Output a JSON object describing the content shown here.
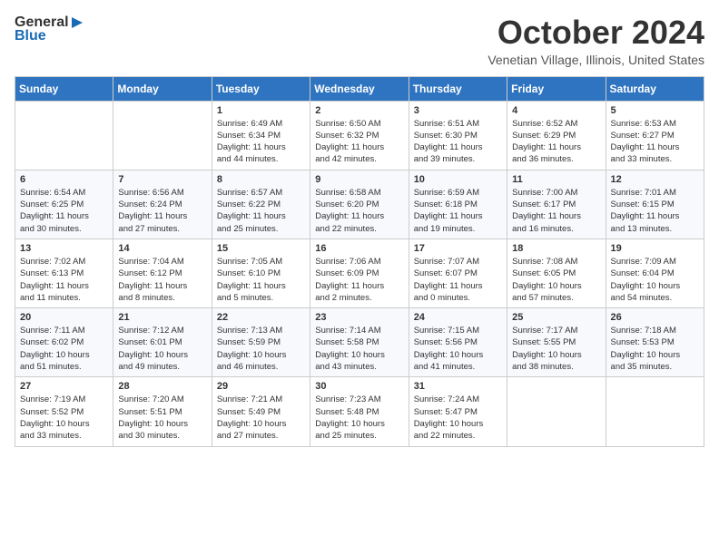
{
  "header": {
    "logo_general": "General",
    "logo_blue": "Blue",
    "month_title": "October 2024",
    "location": "Venetian Village, Illinois, United States"
  },
  "columns": [
    "Sunday",
    "Monday",
    "Tuesday",
    "Wednesday",
    "Thursday",
    "Friday",
    "Saturday"
  ],
  "weeks": [
    [
      {
        "day": "",
        "info": ""
      },
      {
        "day": "",
        "info": ""
      },
      {
        "day": "1",
        "info": "Sunrise: 6:49 AM\nSunset: 6:34 PM\nDaylight: 11 hours\nand 44 minutes."
      },
      {
        "day": "2",
        "info": "Sunrise: 6:50 AM\nSunset: 6:32 PM\nDaylight: 11 hours\nand 42 minutes."
      },
      {
        "day": "3",
        "info": "Sunrise: 6:51 AM\nSunset: 6:30 PM\nDaylight: 11 hours\nand 39 minutes."
      },
      {
        "day": "4",
        "info": "Sunrise: 6:52 AM\nSunset: 6:29 PM\nDaylight: 11 hours\nand 36 minutes."
      },
      {
        "day": "5",
        "info": "Sunrise: 6:53 AM\nSunset: 6:27 PM\nDaylight: 11 hours\nand 33 minutes."
      }
    ],
    [
      {
        "day": "6",
        "info": "Sunrise: 6:54 AM\nSunset: 6:25 PM\nDaylight: 11 hours\nand 30 minutes."
      },
      {
        "day": "7",
        "info": "Sunrise: 6:56 AM\nSunset: 6:24 PM\nDaylight: 11 hours\nand 27 minutes."
      },
      {
        "day": "8",
        "info": "Sunrise: 6:57 AM\nSunset: 6:22 PM\nDaylight: 11 hours\nand 25 minutes."
      },
      {
        "day": "9",
        "info": "Sunrise: 6:58 AM\nSunset: 6:20 PM\nDaylight: 11 hours\nand 22 minutes."
      },
      {
        "day": "10",
        "info": "Sunrise: 6:59 AM\nSunset: 6:18 PM\nDaylight: 11 hours\nand 19 minutes."
      },
      {
        "day": "11",
        "info": "Sunrise: 7:00 AM\nSunset: 6:17 PM\nDaylight: 11 hours\nand 16 minutes."
      },
      {
        "day": "12",
        "info": "Sunrise: 7:01 AM\nSunset: 6:15 PM\nDaylight: 11 hours\nand 13 minutes."
      }
    ],
    [
      {
        "day": "13",
        "info": "Sunrise: 7:02 AM\nSunset: 6:13 PM\nDaylight: 11 hours\nand 11 minutes."
      },
      {
        "day": "14",
        "info": "Sunrise: 7:04 AM\nSunset: 6:12 PM\nDaylight: 11 hours\nand 8 minutes."
      },
      {
        "day": "15",
        "info": "Sunrise: 7:05 AM\nSunset: 6:10 PM\nDaylight: 11 hours\nand 5 minutes."
      },
      {
        "day": "16",
        "info": "Sunrise: 7:06 AM\nSunset: 6:09 PM\nDaylight: 11 hours\nand 2 minutes."
      },
      {
        "day": "17",
        "info": "Sunrise: 7:07 AM\nSunset: 6:07 PM\nDaylight: 11 hours\nand 0 minutes."
      },
      {
        "day": "18",
        "info": "Sunrise: 7:08 AM\nSunset: 6:05 PM\nDaylight: 10 hours\nand 57 minutes."
      },
      {
        "day": "19",
        "info": "Sunrise: 7:09 AM\nSunset: 6:04 PM\nDaylight: 10 hours\nand 54 minutes."
      }
    ],
    [
      {
        "day": "20",
        "info": "Sunrise: 7:11 AM\nSunset: 6:02 PM\nDaylight: 10 hours\nand 51 minutes."
      },
      {
        "day": "21",
        "info": "Sunrise: 7:12 AM\nSunset: 6:01 PM\nDaylight: 10 hours\nand 49 minutes."
      },
      {
        "day": "22",
        "info": "Sunrise: 7:13 AM\nSunset: 5:59 PM\nDaylight: 10 hours\nand 46 minutes."
      },
      {
        "day": "23",
        "info": "Sunrise: 7:14 AM\nSunset: 5:58 PM\nDaylight: 10 hours\nand 43 minutes."
      },
      {
        "day": "24",
        "info": "Sunrise: 7:15 AM\nSunset: 5:56 PM\nDaylight: 10 hours\nand 41 minutes."
      },
      {
        "day": "25",
        "info": "Sunrise: 7:17 AM\nSunset: 5:55 PM\nDaylight: 10 hours\nand 38 minutes."
      },
      {
        "day": "26",
        "info": "Sunrise: 7:18 AM\nSunset: 5:53 PM\nDaylight: 10 hours\nand 35 minutes."
      }
    ],
    [
      {
        "day": "27",
        "info": "Sunrise: 7:19 AM\nSunset: 5:52 PM\nDaylight: 10 hours\nand 33 minutes."
      },
      {
        "day": "28",
        "info": "Sunrise: 7:20 AM\nSunset: 5:51 PM\nDaylight: 10 hours\nand 30 minutes."
      },
      {
        "day": "29",
        "info": "Sunrise: 7:21 AM\nSunset: 5:49 PM\nDaylight: 10 hours\nand 27 minutes."
      },
      {
        "day": "30",
        "info": "Sunrise: 7:23 AM\nSunset: 5:48 PM\nDaylight: 10 hours\nand 25 minutes."
      },
      {
        "day": "31",
        "info": "Sunrise: 7:24 AM\nSunset: 5:47 PM\nDaylight: 10 hours\nand 22 minutes."
      },
      {
        "day": "",
        "info": ""
      },
      {
        "day": "",
        "info": ""
      }
    ]
  ]
}
